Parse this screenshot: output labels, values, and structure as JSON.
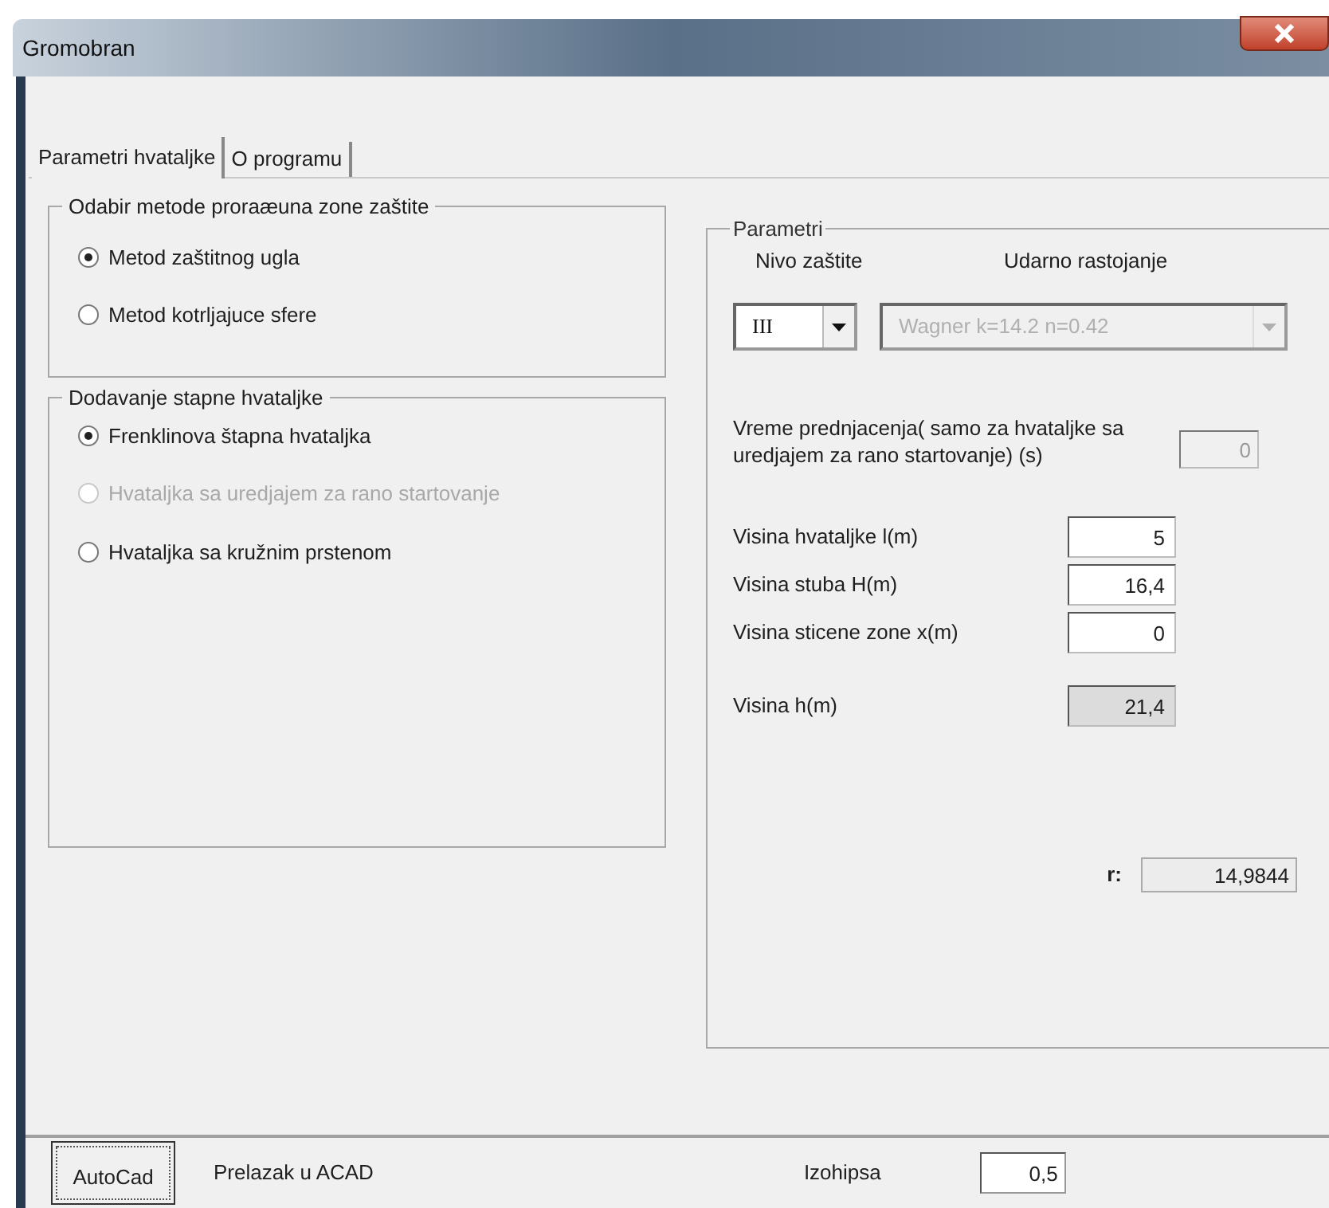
{
  "window": {
    "title": "Gromobran"
  },
  "tabs": [
    {
      "label": "Parametri hvataljke",
      "selected": true
    },
    {
      "label": "O programu",
      "selected": false
    }
  ],
  "method_group": {
    "title": "Odabir metode proraæuna zone zaštite",
    "options": [
      {
        "label": "Metod zaštitnog ugla",
        "selected": true,
        "disabled": false
      },
      {
        "label": "Metod kotrljajuce sfere",
        "selected": false,
        "disabled": false
      }
    ]
  },
  "rod_group": {
    "title": "Dodavanje stapne hvataljke",
    "options": [
      {
        "label": "Frenklinova štapna hvataljka",
        "selected": true,
        "disabled": false
      },
      {
        "label": "Hvataljka sa uredjajem za rano startovanje",
        "selected": false,
        "disabled": true
      },
      {
        "label": "Hvataljka sa kružnim prstenom",
        "selected": false,
        "disabled": false
      }
    ]
  },
  "parameters": {
    "title": "Parametri",
    "level_label": "Nivo zaštite",
    "level_value": "III",
    "level_disabled": false,
    "distance_label": "Udarno rastojanje",
    "distance_value": "Wagner k=14.2 n=0.42",
    "distance_disabled": true,
    "lead_time_label": "Vreme prednjacenja( samo za hvataljke sa uredjajem za rano startovanje) (s)",
    "lead_time_value": "0",
    "lead_time_disabled": true,
    "fields": [
      {
        "label": "Visina hvataljke l(m)",
        "value": "5",
        "readonly": false
      },
      {
        "label": "Visina stuba H(m)",
        "value": "16,4",
        "readonly": false
      },
      {
        "label": "Visina sticene zone x(m)",
        "value": "0",
        "readonly": false
      }
    ],
    "result": {
      "label": "Visina h(m)",
      "value": "21,4",
      "readonly": true
    },
    "r_label": "r:",
    "r_value": "14,9844"
  },
  "bottom": {
    "button": "AutoCad",
    "label": "Prelazak u ACAD",
    "contour_label": "Izohipsa",
    "contour_value": "0,5"
  }
}
